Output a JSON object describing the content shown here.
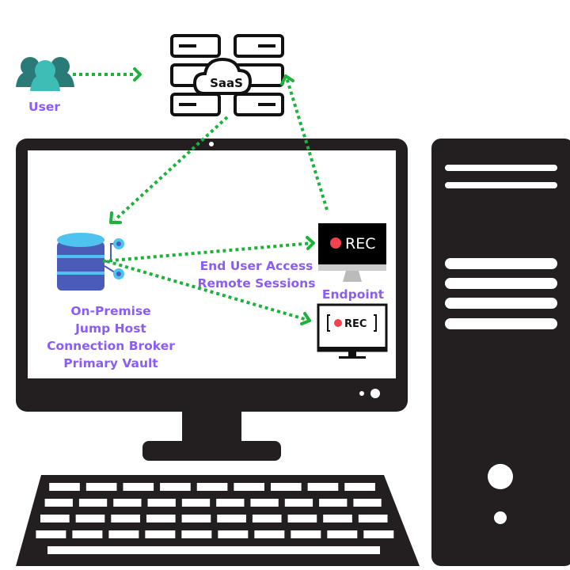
{
  "labels": {
    "user": "User",
    "saas": "SaaS",
    "end_user_access": "End User Access",
    "remote_sessions": "Remote Sessions",
    "endpoint": "Endpoint",
    "on_premise": [
      "On-Premise",
      "Jump Host",
      "Connection Broker",
      "Primary Vault"
    ],
    "rec_top": "REC",
    "rec_bottom": "REC"
  },
  "colors": {
    "label": "#8b5cf6",
    "flow_arrow": "#1db33a",
    "hardware": "#231f20",
    "database": "#4b5bb8",
    "database_accent": "#4fc3f0",
    "rec_dot": "#f0434f",
    "user_icon": "#2a7a78"
  },
  "icons": [
    "users-icon",
    "saas-cloud-server-icon",
    "database-icon",
    "rec-monitor-icon",
    "rec-screen-icon",
    "desktop-computer-icon"
  ]
}
